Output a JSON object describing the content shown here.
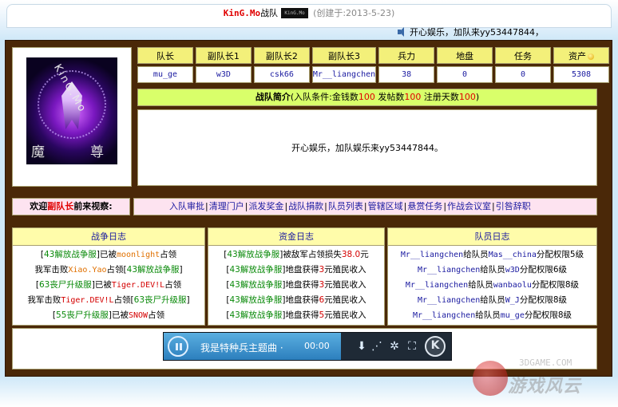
{
  "header": {
    "team_name": "KinG.Mo",
    "team_suffix": "战队",
    "mini_logo_text": "KinG.Mo",
    "created": "(创建于:2013-5-23)",
    "marquee": "开心娱乐，加队来yy53447844，"
  },
  "avatar": {
    "watermark": "KinG.Mo",
    "char_left": "魔",
    "char_right": "尊"
  },
  "roles": {
    "labels": [
      "队长",
      "副队长1",
      "副队长2",
      "副队长3",
      "兵力",
      "地盘",
      "任务",
      "资产"
    ],
    "values": [
      "mu_ge",
      "w3D",
      "csk66",
      "Mr__liangchen",
      "38",
      "0",
      "0",
      "5308"
    ]
  },
  "intro": {
    "title": "战队简介",
    "cond_prefix": "(入队条件:金钱数",
    "money": "100",
    "posts_label": " 发帖数",
    "posts": "100",
    "days_label": " 注册天数",
    "days": "100",
    "cond_suffix": ")",
    "body": "开心娱乐，加队娱乐来yy53447844。"
  },
  "welcome": {
    "prefix": "欢迎",
    "role": "副队长",
    "suffix": "前来视察:"
  },
  "admin_links": [
    "入队审批",
    "清理门户",
    "派发奖金",
    "战队捐款",
    "队员列表",
    "管辖区域",
    "悬赏任务",
    "作战会议室",
    "引咎辞职"
  ],
  "war_log": {
    "title": "战争日志",
    "lines": [
      [
        "[",
        "43解放战争服",
        "]已被",
        "moonlight",
        "占领"
      ],
      [
        "我军击败",
        "Xiao.Yao",
        "占领[",
        "43解放战争服",
        "]"
      ],
      [
        "[",
        "63丧尸升级服",
        "]已被",
        "Tiger.DEV!L",
        "占领"
      ],
      [
        "我军击败",
        "Tiger.DEV!L",
        "占领[",
        "63丧尸升级服",
        "]"
      ],
      [
        "[",
        "55丧尸升级服",
        "]已被",
        "SNOW",
        "占领"
      ]
    ]
  },
  "fund_log": {
    "title": "资金日志",
    "lines": [
      [
        "[",
        "43解放战争服",
        "]被敌军占领损失",
        "38.0",
        "元"
      ],
      [
        "[",
        "43解放战争服",
        "]地盘获得",
        "3",
        "元殖民收入"
      ],
      [
        "[",
        "43解放战争服",
        "]地盘获得",
        "3",
        "元殖民收入"
      ],
      [
        "[",
        "43解放战争服",
        "]地盘获得",
        "6",
        "元殖民收入"
      ],
      [
        "[",
        "43解放战争服",
        "]地盘获得",
        "5",
        "元殖民收入"
      ]
    ]
  },
  "member_log": {
    "title": "队员日志",
    "lines": [
      [
        "Mr__liangchen",
        "给队员",
        "Mas__china",
        "分配权限5级"
      ],
      [
        "Mr__liangchen",
        "给队员",
        "w3D",
        "分配权限6级"
      ],
      [
        "Mr__liangchen",
        "给队员",
        "wanbaolu",
        "分配权限8级"
      ],
      [
        "Mr__liangchen",
        "给队员",
        "W_J",
        "分配权限8级"
      ],
      [
        "Mr__liangchen",
        "给队员",
        "mu_ge",
        "分配权限8级"
      ]
    ]
  },
  "player": {
    "track": "我是特种兵主题曲 · ",
    "time": "00:00",
    "close": "K"
  },
  "site_watermark": {
    "top": "3DGAME.COM",
    "text": "游戏风云"
  },
  "colors": {
    "frame_brown": "#4a2808",
    "header_yellow": "#f3f07a",
    "intro_green": "#d9ff6a",
    "admin_pink": "#fde3f0",
    "link_blue": "#1a1aa0",
    "highlight_red": "#e00000"
  },
  "icons": {
    "speaker": "speaker-icon",
    "coin": "coin-icon",
    "pause": "pause-icon",
    "download": "download-icon",
    "share": "share-icon",
    "settings": "settings-icon",
    "fullscreen": "fullscreen-icon",
    "close": "close-icon"
  }
}
